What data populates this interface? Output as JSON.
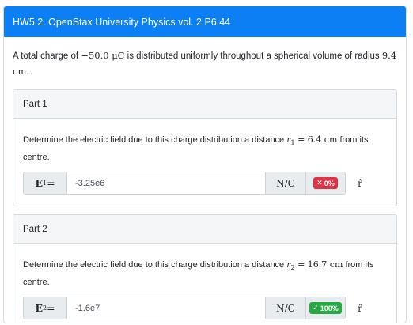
{
  "header": {
    "title": "HW5.2. OpenStax University Physics vol. 2 P6.44"
  },
  "question": {
    "t1": "A total charge of ",
    "charge": "−50.0 μC",
    "t2": " is distributed uniformly throughout a spherical volume of radius ",
    "radius": "9.4 cm",
    "t3": "."
  },
  "parts": [
    {
      "label": "Part 1",
      "text_before": "Determine the electric field due to this charge distribution a distance ",
      "r_name": "r",
      "r_sub": "1",
      "r_value": " = 6.4 cm",
      "text_after": " from its centre.",
      "field_name": "E",
      "field_sub": "1",
      "field_eq": " =",
      "answer": "-3.25e6",
      "unit": "N/C",
      "score_text": "0%",
      "score_symbol": "✕",
      "score_status": "incorrect",
      "help_symbol": "r̂"
    },
    {
      "label": "Part 2",
      "text_before": "Determine the electric field due to this charge distribution a distance ",
      "r_name": "r",
      "r_sub": "2",
      "r_value": " = 16.7 cm",
      "text_after": " from its centre.",
      "field_name": "E",
      "field_sub": "2",
      "field_eq": " =",
      "answer": "-1.6e7",
      "unit": "N/C",
      "score_text": "100%",
      "score_symbol": "✓",
      "score_status": "correct",
      "help_symbol": "r̂"
    }
  ],
  "colors": {
    "header": "#0d7ff5",
    "incorrect": "#dc3545",
    "correct": "#28a745"
  }
}
